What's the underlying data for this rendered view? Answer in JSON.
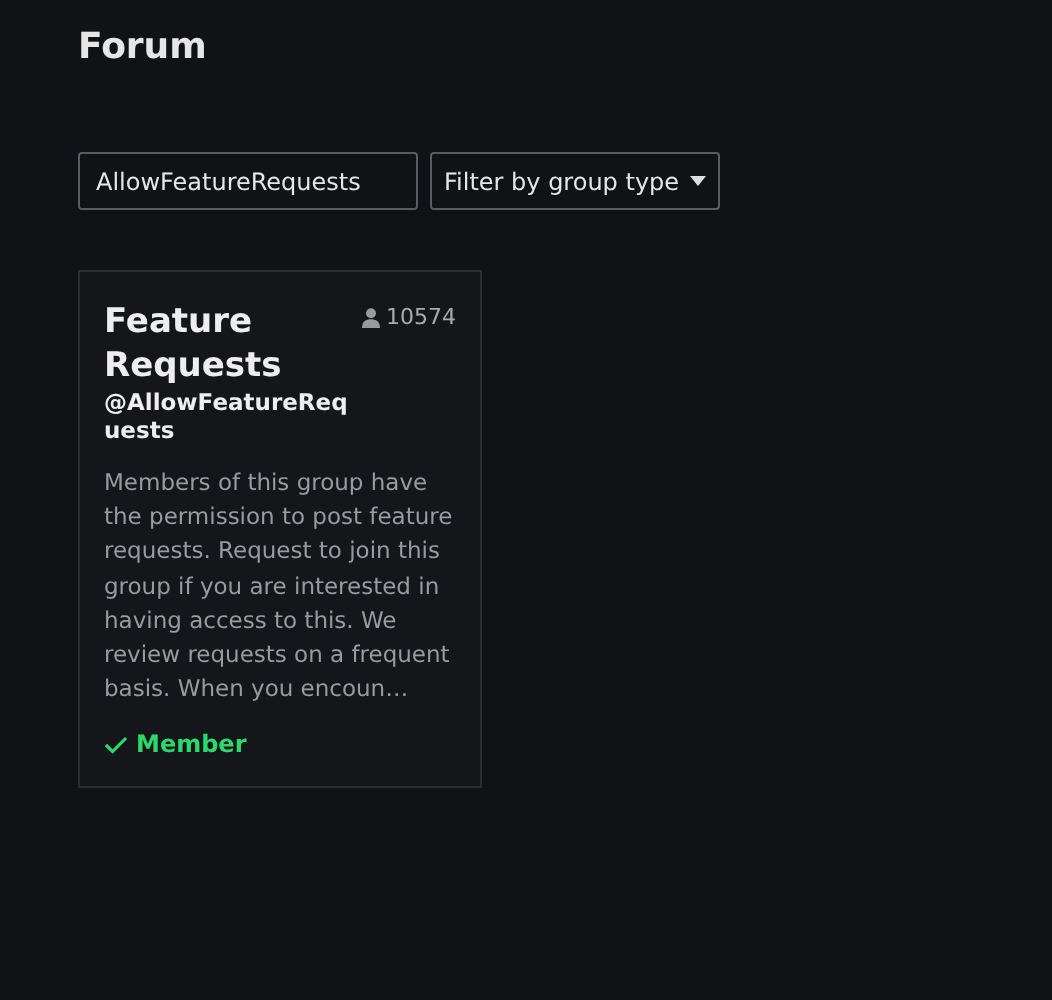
{
  "page": {
    "title": "Forum"
  },
  "search": {
    "value": "AllowFeatureRequests"
  },
  "filter": {
    "label": "Filter by group type"
  },
  "groups": [
    {
      "name": "Feature Requests",
      "handle": "@AllowFeatureRequests",
      "member_count": "10574",
      "description": "Members of this group have the permission to post feature requests. Request to join this group if you are interested in having access to this. We review requests on a frequent basis. When you encoun…",
      "member": true,
      "member_label": "Member"
    }
  ]
}
